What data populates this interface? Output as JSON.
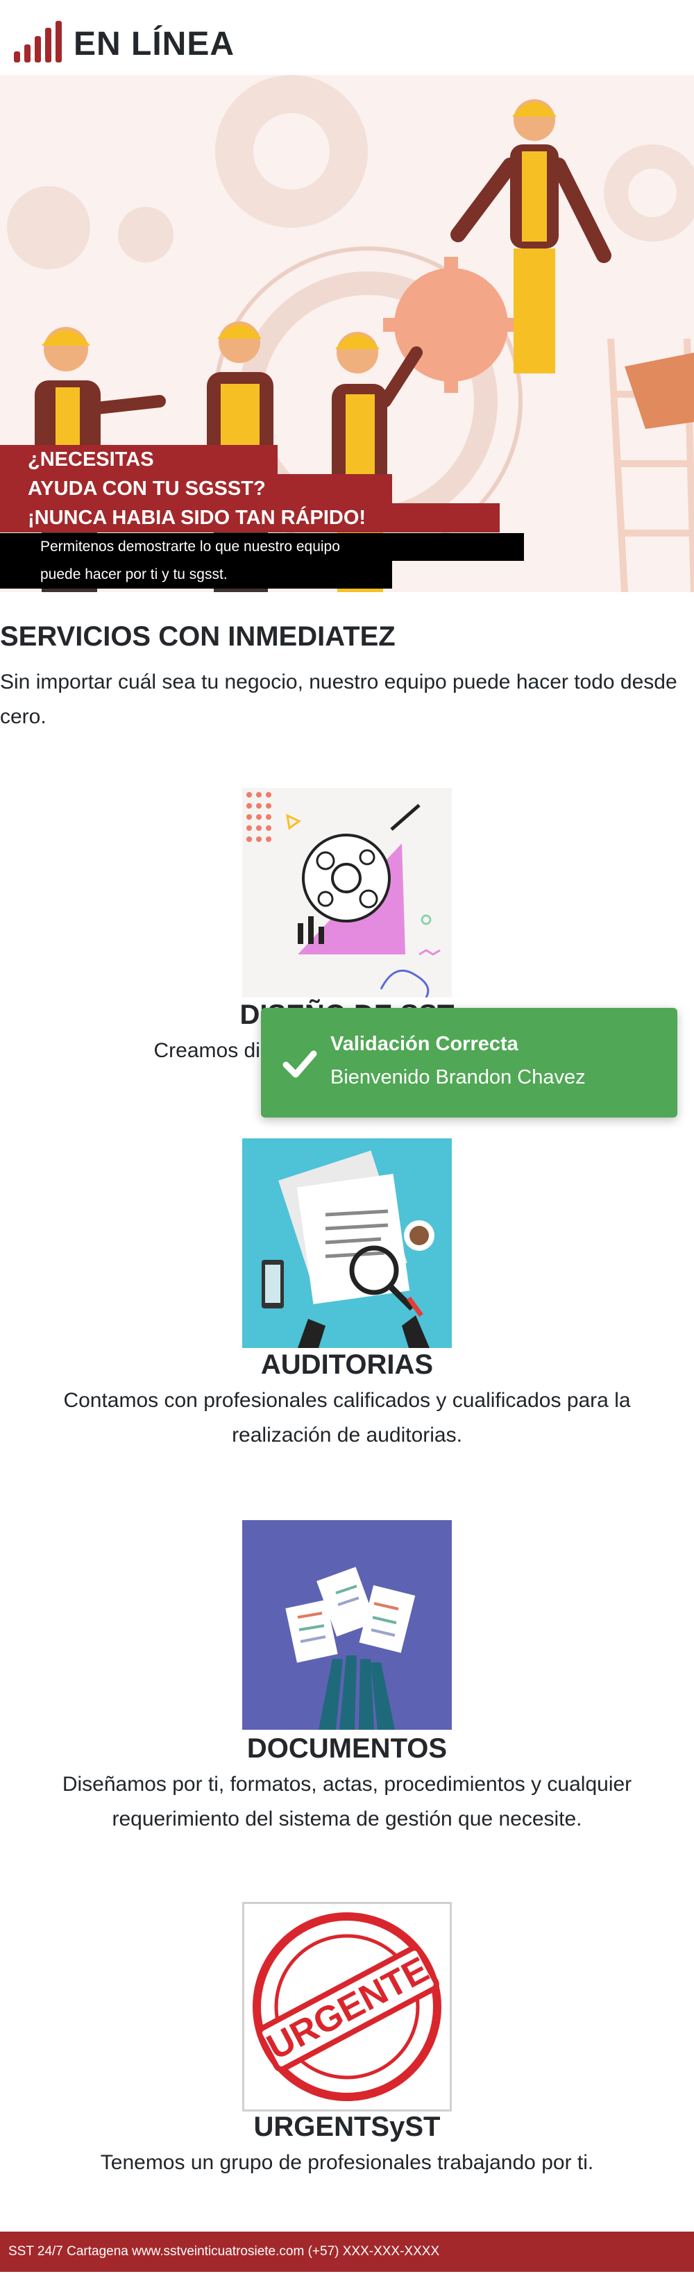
{
  "brand": {
    "name": "EN LÍNEA",
    "accent_color": "#a3282b",
    "logo_icon": "signal-bars-icon"
  },
  "hero": {
    "line1": "¿NECESITAS",
    "line2": "AYUDA CON TU SGSST?",
    "line3": "¡NUNCA HABIA SIDO TAN RÁPIDO!",
    "sub1": "Permitenos demostrarte lo que nuestro equipo",
    "sub2": "puede hacer por ti y tu sgsst."
  },
  "services_section": {
    "title": "SERVICIOS CON INMEDIATEZ",
    "description": "Sin importar cuál sea tu negocio, nuestro equipo puede hacer todo desde cero."
  },
  "services": [
    {
      "title": "DISEÑO DE SST",
      "description": "Creamos diseños según tus necesidades.",
      "image_icon": "design-gears-illustration"
    },
    {
      "title": "AUDITORIAS",
      "description": "Contamos con profesionales calificados y cualificados para la realización de auditorias.",
      "image_icon": "audit-magnifier-illustration"
    },
    {
      "title": "DOCUMENTOS",
      "description": "Diseñamos por ti, formatos, actas, procedimientos y cualquier requerimiento del sistema de gestión que necesite.",
      "image_icon": "documents-hands-illustration"
    },
    {
      "title": "URGENTSyST",
      "description": "Tenemos un grupo de profesionales trabajando por ti.",
      "image_icon": "urgente-stamp-illustration"
    }
  ],
  "toast": {
    "title": "Validación Correcta",
    "message": "Bienvenido Brandon Chavez",
    "icon": "checkmark-icon",
    "color": "#50a755"
  },
  "footer": {
    "text": "SST 24/7 Cartagena www.sstveinticuatrosiete.com (+57) XXX-XXX-XXXX"
  }
}
